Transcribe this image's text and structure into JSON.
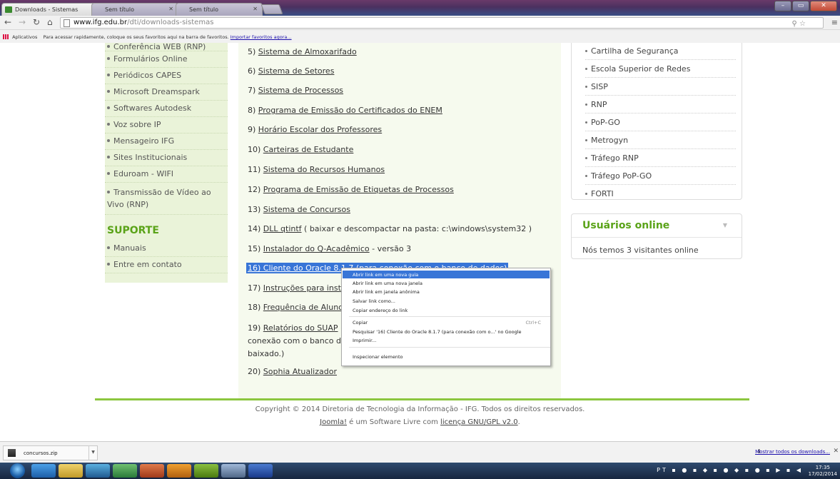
{
  "browser": {
    "tabs": [
      {
        "title": "Downloads - Sistemas",
        "active": true
      },
      {
        "title": "Sem título",
        "active": false
      },
      {
        "title": "Sem título",
        "active": false
      }
    ],
    "url_host": "www.ifg.edu.br",
    "url_path": "/dti/downloads-sistemas",
    "bookmarks_apps": "Aplicativos",
    "bookmarks_hint": "Para acessar rapidamente, coloque os seus favoritos aqui na barra de favoritos.",
    "bookmarks_import": "Importar favoritos agora..."
  },
  "left_menu": {
    "items": [
      "Conferência WEB (RNP)",
      "Formulários Online",
      "Periódicos CAPES",
      "Microsoft Dreamspark",
      "Softwares Autodesk",
      "Voz sobre IP",
      "Mensageiro IFG",
      "Sites Institucionais",
      "Eduroam - WIFI",
      "Transmissão de Vídeo ao Vivo (RNP)"
    ],
    "support_heading": "SUPORTE",
    "support_items": [
      "Manuais",
      "Entre em contato"
    ]
  },
  "main_list": {
    "i5": {
      "num": "5) ",
      "link": "Sistema de Almoxarifado"
    },
    "i6": {
      "num": "6) ",
      "link": "Sistema de Setores"
    },
    "i7": {
      "num": "7) ",
      "link": "Sistema de Processos"
    },
    "i8": {
      "num": "8) ",
      "link": "Programa de Emissão do Certificados do ENEM"
    },
    "i9": {
      "num": "9) ",
      "link": "Horário Escolar dos Professores"
    },
    "i10": {
      "num": "10) ",
      "link": "Carteiras de Estudante"
    },
    "i11": {
      "num": "11) ",
      "link": "Sistema do Recursos Humanos"
    },
    "i12": {
      "num": "12) ",
      "link": "Programa de Emissão de Etiquetas de Processos"
    },
    "i13": {
      "num": "13) ",
      "link": "Sistema de Concursos"
    },
    "i14": {
      "num": "14) ",
      "link": "DLL qtintf",
      "suffix": " ( baixar e descompactar na pasta: c:\\windows\\system32 )"
    },
    "i15": {
      "num": "15) ",
      "link": "Instalador do Q-Acadêmico",
      "suffix": " - versão 3"
    },
    "i16": {
      "link": "16) Cliente do Oracle 8.1.7 (para conexão com o banco de dados)"
    },
    "i17": {
      "num": "17) ",
      "link": "Instruções para instala"
    },
    "i18": {
      "num": "18) ",
      "link": "Frequência de Alunos"
    },
    "i19": {
      "num": "19) ",
      "link": "Relatórios do SUAP",
      "line1_suffix": " (",
      "line2": "conexão com o banco de",
      "line3": "baixado.)"
    },
    "i20": {
      "num": "20) ",
      "link": "Sophia Atualizador"
    }
  },
  "right_menu": {
    "items": [
      "Cartilha de Segurança",
      "Escola Superior de Redes",
      "SISP",
      "RNP",
      "PoP-GO",
      "Metrogyn",
      "Tráfego RNP",
      "Tráfego PoP-GO",
      "FORTI"
    ]
  },
  "online": {
    "title": "Usuários online",
    "text": "Nós temos 3 visitantes online"
  },
  "footer": {
    "copyright": "Copyright © 2014 Diretoria de Tecnologia da Informação - IFG. Todos os direitos reservados.",
    "joomla": "Joomla!",
    "middle": " é um Software Livre com ",
    "license": "licença GNU/GPL v2.0",
    "end": "."
  },
  "context_menu": {
    "items": [
      "Abrir link em uma nova guia",
      "Abrir link em uma nova janela",
      "Abrir link em janela anônima",
      "Salvar link como...",
      "Copiar endereço do link",
      "Copiar",
      "Pesquisar '16) Cliente do Oracle 8.1.7 (para conexão com o...' no Google",
      "Imprimir...",
      "Inspecionar elemento"
    ],
    "copy_shortcut": "Ctrl+C"
  },
  "downloads": {
    "file": "concursos.zip",
    "show_all": "Mostrar todos os downloads..."
  },
  "taskbar": {
    "lang": "PT",
    "time": "17:35",
    "date": "17/02/2014"
  },
  "colors": {
    "accent_green": "#5aa318",
    "border_green": "#8cc63f",
    "selection_blue": "#3875d7"
  }
}
